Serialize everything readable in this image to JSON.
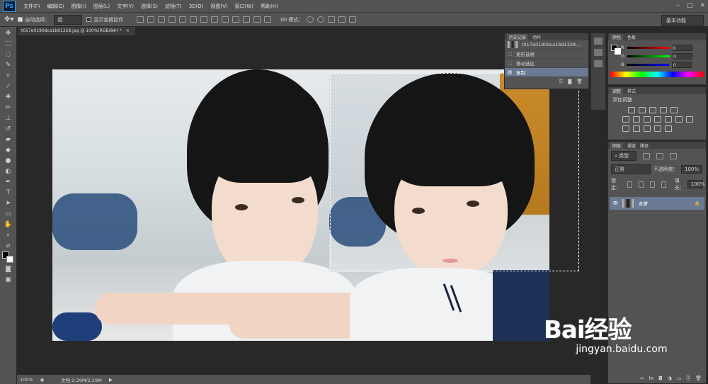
{
  "app": {
    "logo": "Ps"
  },
  "menu": [
    "文件(F)",
    "编辑(E)",
    "图像(I)",
    "图层(L)",
    "文字(Y)",
    "选择(S)",
    "滤镜(T)",
    "3D(D)",
    "视图(V)",
    "窗口(W)",
    "帮助(H)"
  ],
  "options": {
    "auto_select": "自动选择：",
    "auto_select_value": "组",
    "show_transform": "显示变换控件",
    "mode_3d": "3D 模式：",
    "workspace": "基本功能"
  },
  "document": {
    "tab_title": "t017e0190dca1b91328.jpg @ 100%(RGB/8#) *"
  },
  "history": {
    "tab_active": "历史记录",
    "tab_other": "动作",
    "snapshot": "t017e0190dca1b91328....",
    "items": [
      "矩形选框",
      "移动选区",
      "复制"
    ],
    "selected_index": 2
  },
  "color_panel": {
    "tab_active": "颜色",
    "tab_other": "色板",
    "channels": [
      {
        "label": "R",
        "value": "0",
        "color": "#ff3030"
      },
      {
        "label": "G",
        "value": "0",
        "color": "#30d030"
      },
      {
        "label": "B",
        "value": "0",
        "color": "#3050ff"
      }
    ]
  },
  "adjust_panel": {
    "tab_active": "调整",
    "tab_other": "样式",
    "title": "添加调整"
  },
  "layers_panel": {
    "tabs": [
      "图层",
      "通道",
      "路径"
    ],
    "kind": "类型",
    "blend": "正常",
    "opacity_label": "不透明度：",
    "opacity_value": "100%",
    "lock_label": "锁定：",
    "fill_label": "填充：",
    "fill_value": "100%",
    "layer_name": "背景"
  },
  "status": {
    "zoom": "100%",
    "doc_size": "文档:2.29M/2.29M"
  },
  "watermark": {
    "main": "Bai经验",
    "sub": "jingyan.baidu.com"
  }
}
